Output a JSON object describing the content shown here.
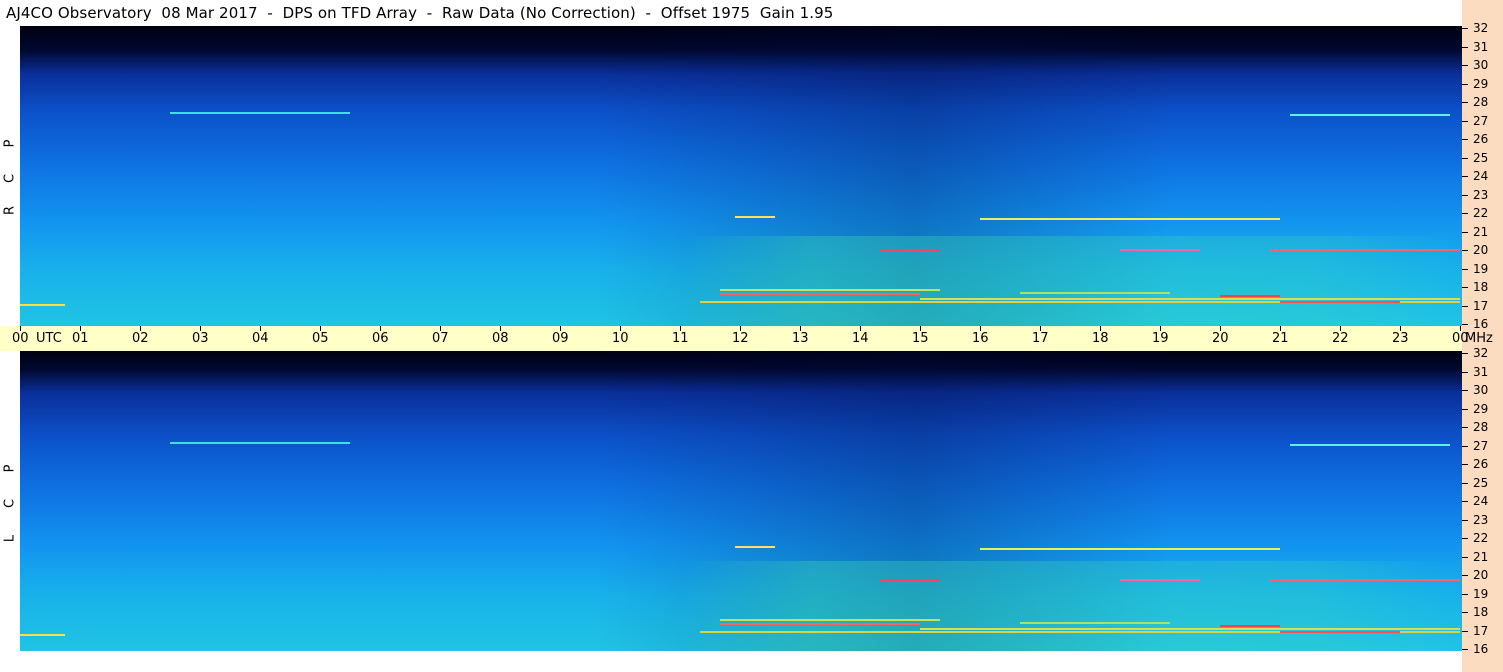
{
  "title": "AJ4CO Observatory  08 Mar 2017  -  DPS on TFD Array  -  Raw Data (No Correction)  -  Offset 1975  Gain 1.95",
  "panels": [
    {
      "id": "rcp",
      "polarization_letters": [
        "P",
        "C",
        "R"
      ]
    },
    {
      "id": "lcp",
      "polarization_letters": [
        "P",
        "C",
        "L"
      ]
    }
  ],
  "time_axis": {
    "unit_label": "UTC",
    "frequency_unit_label": "MHz",
    "hours": [
      "00",
      "01",
      "02",
      "03",
      "04",
      "05",
      "06",
      "07",
      "08",
      "09",
      "10",
      "11",
      "12",
      "13",
      "14",
      "15",
      "16",
      "17",
      "18",
      "19",
      "20",
      "21",
      "22",
      "23",
      "00"
    ]
  },
  "frequency_axis": {
    "labels": [
      "32",
      "31",
      "30",
      "29",
      "28",
      "27",
      "26",
      "25",
      "24",
      "23",
      "22",
      "21",
      "20",
      "19",
      "18",
      "17",
      "16"
    ]
  },
  "colors": {
    "title_background": "#ffffff",
    "time_axis_background": "#ffffc8",
    "freq_axis_background": "#fcdcc1",
    "spectrogram_low": "#000018",
    "spectrogram_mid": "#1296f0",
    "spectrogram_high": "#27d3d8",
    "interference_lines": "#ffe040"
  }
}
